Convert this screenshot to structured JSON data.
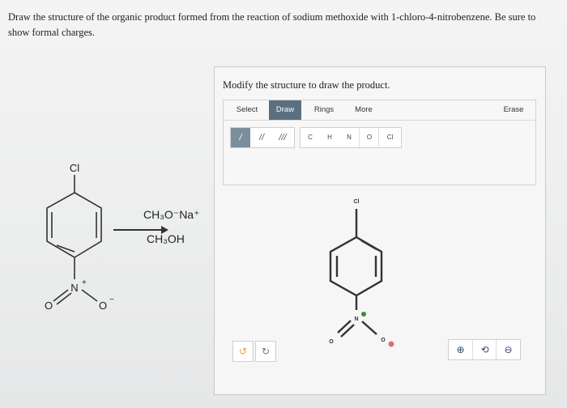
{
  "question": "Draw the structure of the organic product formed from the reaction of sodium methoxide with 1-chloro-4-nitrobenzene. Be sure to show formal charges.",
  "scheme": {
    "top_substituent": "Cl",
    "nitro_n": "N",
    "nitro_n_charge": "+",
    "nitro_o_left": "O",
    "nitro_o_right": "O",
    "nitro_o_charge": "−",
    "reagent_above": "CH₃O⁻Na⁺",
    "reagent_below": "CH₃OH"
  },
  "panel": {
    "title": "Modify the structure to draw the product.",
    "tabs": [
      "Select",
      "Draw",
      "Rings",
      "More",
      "Erase"
    ],
    "active_tab": "Draw",
    "bond_tools": [
      "/",
      "//",
      "///"
    ],
    "atom_tools": [
      "C",
      "H",
      "N",
      "O",
      "Cl"
    ],
    "canvas_labels": {
      "cl": "Cl",
      "n": "N",
      "o_left": "O",
      "o_right": "O"
    },
    "undo": "↺",
    "redo": "↻",
    "zoom_in": "⊕",
    "zoom_reset": "⟲",
    "zoom_out": "⊖"
  },
  "colors": {
    "active_tab": "#5a7080",
    "selected_tool": "#7a8e9c",
    "plus_charge": "#3a8c3a",
    "minus_charge": "#e07070"
  }
}
